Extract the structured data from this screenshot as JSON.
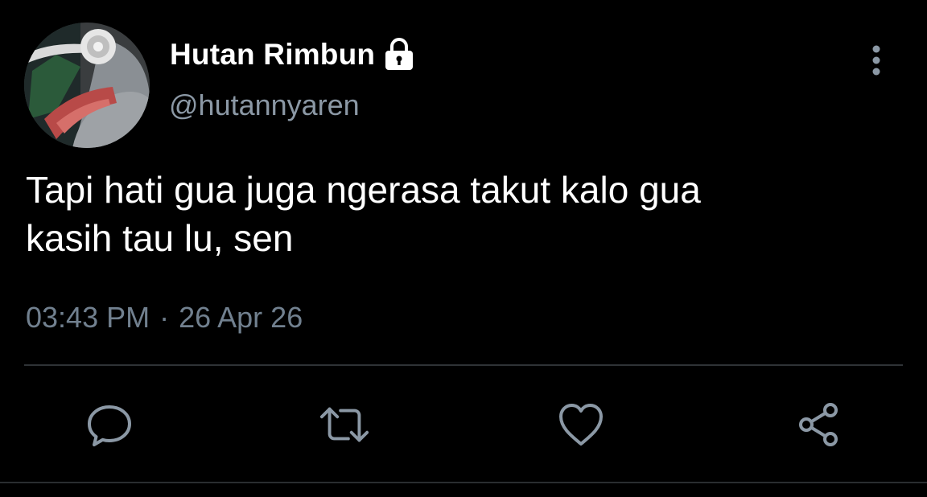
{
  "user": {
    "display_name": "Hutan Rimbun",
    "handle": "@hutannyaren",
    "protected_icon": "lock-icon",
    "avatar": "profile-photo"
  },
  "tweet": {
    "text": "Tapi hati gua juga ngerasa takut kalo gua\nkasih tau lu, sen",
    "time": "03:43 PM",
    "separator": "·",
    "date": "26 Apr 26"
  },
  "actions": [
    {
      "icon": "reply-icon"
    },
    {
      "icon": "retweet-icon"
    },
    {
      "icon": "like-icon"
    },
    {
      "icon": "share-icon"
    }
  ],
  "menu": {
    "icon": "more-vertical-icon"
  },
  "colors": {
    "background": "#000000",
    "text": "#ffffff",
    "secondary_text": "#8b98a5",
    "icon": "#8b98a5",
    "divider": "#2f3336"
  }
}
